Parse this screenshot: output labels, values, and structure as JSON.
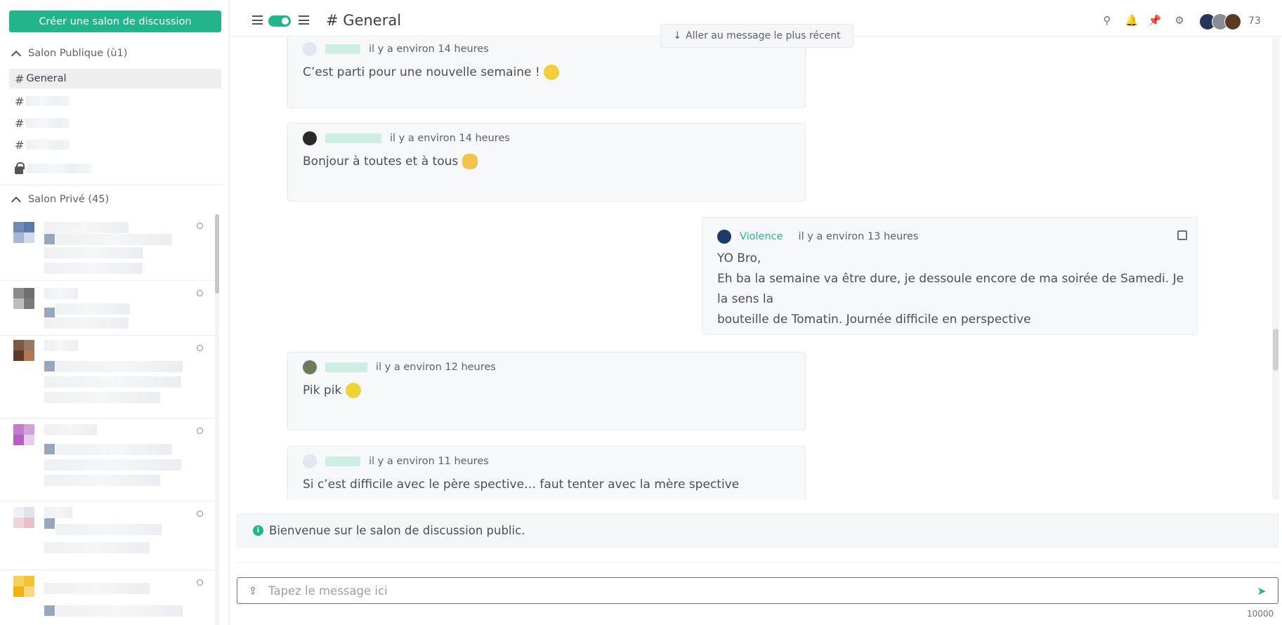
{
  "sidebar": {
    "create_label": "Créer une salon de discussion",
    "public_header": "Salon Publique (ù1)",
    "private_header": "Salon Privé (45)",
    "active_channel": "General"
  },
  "header": {
    "title": "General",
    "jump_label": "Aller au message le plus récent",
    "member_count": "73"
  },
  "messages": [
    {
      "time": "il y a environ 14 heures",
      "text": "C’est parti pour une nouvelle semaine !"
    },
    {
      "time": "il y a environ 14 heures",
      "text": "Bonjour à toutes et à tous"
    },
    {
      "author": "Violence",
      "time": "il y a environ 13 heures",
      "lines": [
        "YO Bro,",
        "Eh ba la semaine va être dure, je dessoule encore de ma soirée de Samedi. Je la sens la",
        "bouteille de Tomatin. Journée difficile en perspective"
      ]
    },
    {
      "time": "il y a environ 12 heures",
      "text": "Pik pik"
    },
    {
      "time": "il y a environ 11 heures",
      "text": "Si c’est difficile avec le père spective… faut tenter avec la mère spective"
    }
  ],
  "notice": "Bienvenue sur le salon de discussion public.",
  "composer": {
    "placeholder": "Tapez le message ici",
    "char_limit": "10000"
  },
  "colors": {
    "accent": "#22b58c"
  }
}
